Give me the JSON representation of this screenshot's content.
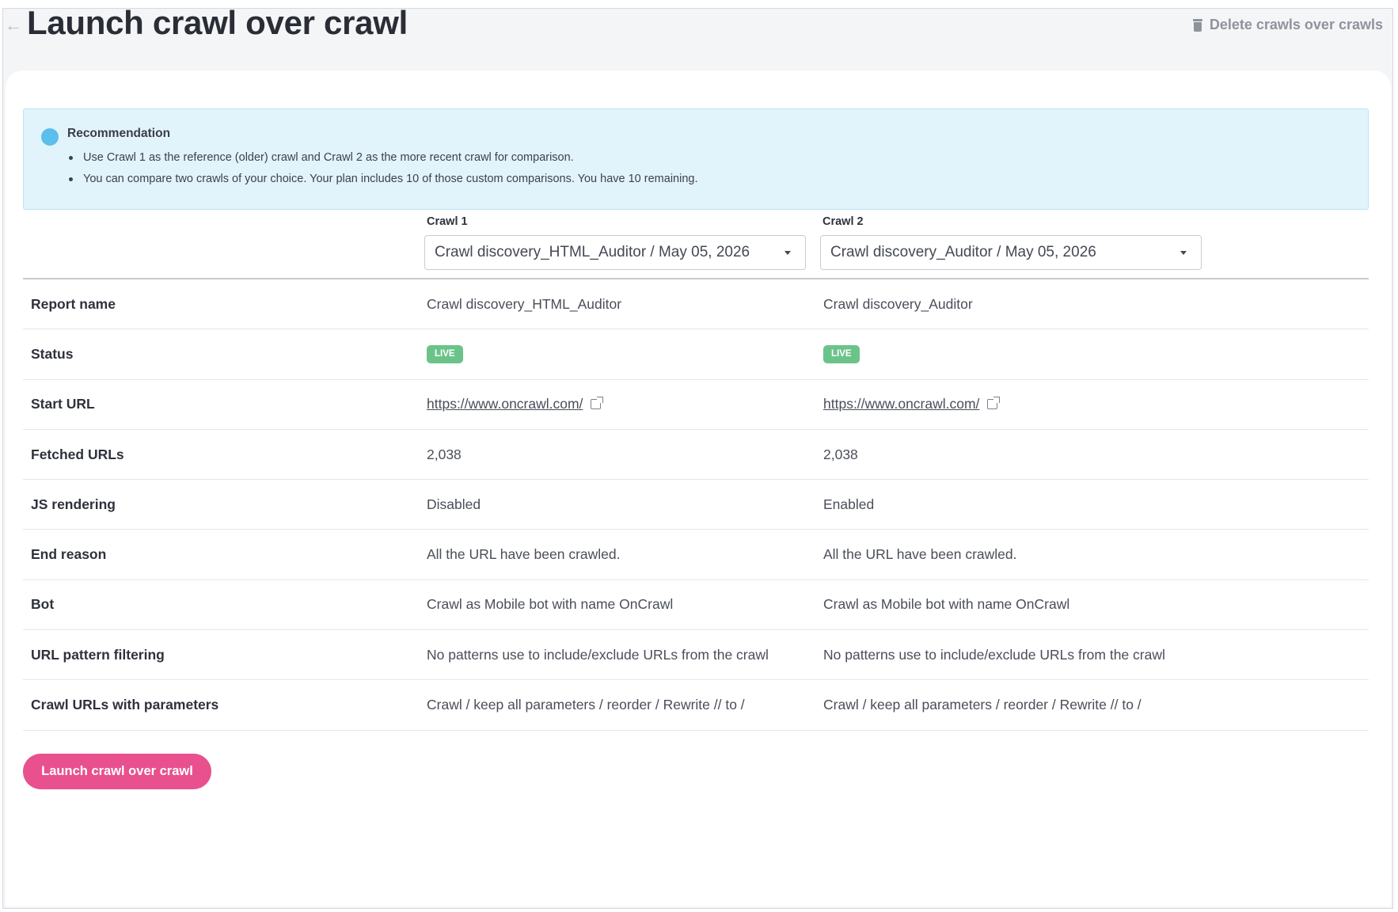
{
  "header": {
    "back_icon": "arrow-left-icon",
    "title": "Launch crawl over crawl",
    "delete_label": "Delete crawls over crawls",
    "delete_icon": "trash-icon"
  },
  "recommendation": {
    "icon": "info-icon",
    "title": "Recommendation",
    "items": [
      "Use Crawl 1 as the reference (older) crawl and Crawl 2 as the more recent crawl for comparison.",
      "You can compare two crawls of your choice. Your plan includes 10 of those custom comparisons. You have 10 remaining."
    ]
  },
  "crawl1": {
    "label": "Crawl 1",
    "selected": "Crawl discovery_HTML_Auditor / May 05, 2026"
  },
  "crawl2": {
    "label": "Crawl 2",
    "selected": "Crawl discovery_Auditor / May 05, 2026"
  },
  "rows": [
    {
      "label": "Report name",
      "c1": "Crawl discovery_HTML_Auditor",
      "c2": "Crawl discovery_Auditor"
    },
    {
      "label": "Status",
      "c1": "LIVE",
      "c2": "LIVE"
    },
    {
      "label": "Start URL",
      "c1": "https://www.oncrawl.com/",
      "c2": "https://www.oncrawl.com/"
    },
    {
      "label": "Fetched URLs",
      "c1": "2,038",
      "c2": "2,038"
    },
    {
      "label": "JS rendering",
      "c1": "Disabled",
      "c2": "Enabled"
    },
    {
      "label": "End reason",
      "c1": "All the URL have been crawled.",
      "c2": "All the URL have been crawled."
    },
    {
      "label": "Bot",
      "c1": "Crawl as Mobile bot with name OnCrawl",
      "c2": "Crawl as Mobile bot with name OnCrawl"
    },
    {
      "label": "URL pattern filtering",
      "c1": "No patterns use to include/exclude URLs from the crawl",
      "c2": "No patterns use to include/exclude URLs from the crawl"
    },
    {
      "label": "Crawl URLs with parameters",
      "c1": "Crawl / keep all parameters / reorder / Rewrite // to /",
      "c2": "Crawl / keep all parameters / reorder / Rewrite // to /"
    }
  ],
  "launch_button": "Launch crawl over crawl",
  "colors": {
    "accent": "#e8508e",
    "live": "#6cc38a",
    "info_bg": "#e1f4fb",
    "info_icon": "#5bbfec"
  }
}
